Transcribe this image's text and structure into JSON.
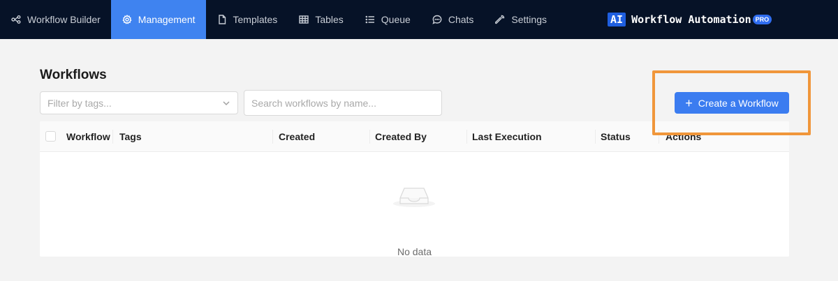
{
  "nav": {
    "items": [
      {
        "label": "Workflow Builder",
        "icon": "workflow-icon",
        "active": false
      },
      {
        "label": "Management",
        "icon": "gear-icon",
        "active": true
      },
      {
        "label": "Templates",
        "icon": "document-icon",
        "active": false
      },
      {
        "label": "Tables",
        "icon": "table-icon",
        "active": false
      },
      {
        "label": "Queue",
        "icon": "list-icon",
        "active": false
      },
      {
        "label": "Chats",
        "icon": "chat-icon",
        "active": false
      },
      {
        "label": "Settings",
        "icon": "wrench-icon",
        "active": false
      }
    ],
    "brand": {
      "badge": "AI",
      "name": "Workflow Automation",
      "tier": "PRO"
    }
  },
  "page": {
    "title": "Workflows",
    "tag_filter_placeholder": "Filter by tags...",
    "search_placeholder": "Search workflows by name...",
    "create_button_label": "Create a Workflow"
  },
  "table": {
    "columns": [
      "Workflow",
      "Tags",
      "Created",
      "Created By",
      "Last Execution",
      "Status",
      "Actions"
    ],
    "rows": [],
    "empty_text": "No data"
  },
  "colors": {
    "nav_bg": "#061227",
    "accent": "#3b7cf0",
    "highlight": "#f0963a"
  }
}
